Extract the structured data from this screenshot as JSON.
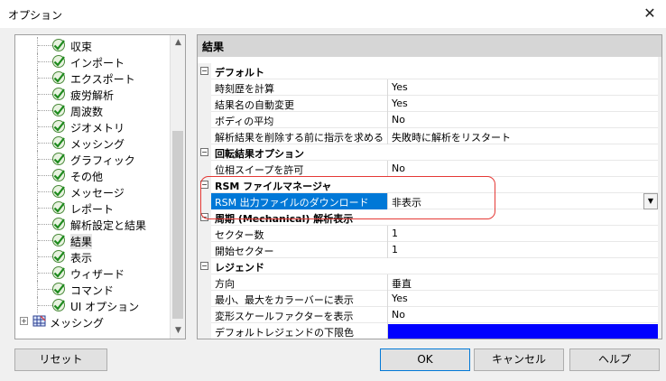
{
  "window": {
    "title": "オプション",
    "close_icon": "close-icon"
  },
  "tree": {
    "items": [
      {
        "label": "収束"
      },
      {
        "label": "インポート"
      },
      {
        "label": "エクスポート"
      },
      {
        "label": "疲労解析"
      },
      {
        "label": "周波数"
      },
      {
        "label": "ジオメトリ"
      },
      {
        "label": "メッシング"
      },
      {
        "label": "グラフィック"
      },
      {
        "label": "その他"
      },
      {
        "label": "メッセージ"
      },
      {
        "label": "レポート"
      },
      {
        "label": "解析設定と結果"
      },
      {
        "label": "結果",
        "selected": true
      },
      {
        "label": "表示"
      },
      {
        "label": "ウィザード"
      },
      {
        "label": "コマンド"
      },
      {
        "label": "UI オプション"
      }
    ],
    "root_item": {
      "label": "メッシング",
      "expander": "+"
    }
  },
  "panel": {
    "header": "結果",
    "categories": [
      {
        "label": "デフォルト",
        "rows": [
          {
            "name": "時刻歴を計算",
            "value": "Yes"
          },
          {
            "name": "結果名の自動変更",
            "value": "Yes"
          },
          {
            "name": "ボディの平均",
            "value": "No"
          },
          {
            "name": "解析結果を削除する前に指示を求める",
            "value": "失敗時に解析をリスタート"
          }
        ]
      },
      {
        "label": "回転結果オプション",
        "rows": [
          {
            "name": "位相スイープを許可",
            "value": "No"
          }
        ]
      },
      {
        "label": "RSM ファイルマネージャ",
        "rows": [
          {
            "name": "RSM 出力ファイルのダウンロード",
            "value": "非表示",
            "selected": true,
            "dropdown": true
          }
        ]
      },
      {
        "label": "周期 (Mechanical) 解析表示",
        "rows": [
          {
            "name": "セクター数",
            "value": "1"
          },
          {
            "name": "開始セクター",
            "value": "1"
          }
        ]
      },
      {
        "label": "レジェンド",
        "rows": [
          {
            "name": "方向",
            "value": "垂直"
          },
          {
            "name": "最小、最大をカラーバーに表示",
            "value": "Yes"
          },
          {
            "name": "変形スケールファクターを表示",
            "value": "No"
          },
          {
            "name": "デフォルトレジェンドの下限色",
            "value": "",
            "color": "#0000ff"
          }
        ]
      }
    ]
  },
  "buttons": {
    "reset": "リセット",
    "ok": "OK",
    "cancel": "キャンセル",
    "help": "ヘルプ"
  },
  "colors": {
    "selection": "#0078d7",
    "highlight_ring": "#e53935",
    "legend_low_color": "#0000ff"
  }
}
